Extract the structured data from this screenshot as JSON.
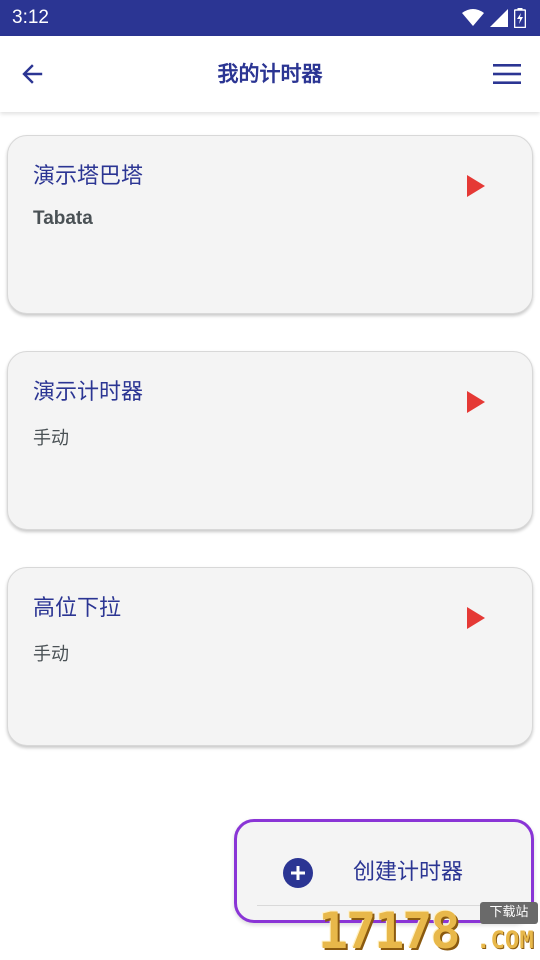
{
  "status_bar": {
    "time": "3:12",
    "icons": [
      "wifi-icon",
      "cellular-signal-icon",
      "battery-icon"
    ]
  },
  "app_bar": {
    "title": "我的计时器",
    "back_icon": "arrow-left-icon",
    "menu_icon": "hamburger-menu-icon"
  },
  "timers": [
    {
      "name": "演示塔巴塔",
      "type": "Tabata"
    },
    {
      "name": "演示计时器",
      "type": "手动"
    },
    {
      "name": "高位下拉",
      "type": "手动"
    }
  ],
  "fab": {
    "label": "创建计时器",
    "icon": "plus-circle-icon"
  },
  "watermark": {
    "number": "17178",
    "suffix": ".COM",
    "tag": "下载站"
  },
  "colors": {
    "primary": "#2b3593",
    "play": "#e53935",
    "card_bg": "#f4f4f4",
    "fab_border": "#8a35d6"
  }
}
